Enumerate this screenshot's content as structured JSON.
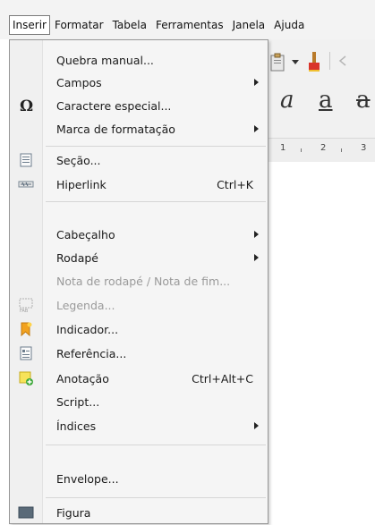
{
  "menubar": {
    "items": [
      {
        "label": "Inserir",
        "active": true
      },
      {
        "label": "Formatar"
      },
      {
        "label": "Tabela"
      },
      {
        "label": "Ferramentas"
      },
      {
        "label": "Janela"
      },
      {
        "label": "Ajuda"
      }
    ]
  },
  "background": {
    "ruler_numbers": [
      "1",
      "2",
      "3"
    ],
    "format_chars": [
      "a",
      "a",
      "a"
    ]
  },
  "insert_menu": {
    "items": [
      {
        "label": "Quebra manual...",
        "icon": "none"
      },
      {
        "label": "Campos",
        "submenu": true
      },
      {
        "label": "Caractere especial...",
        "icon": "omega-icon"
      },
      {
        "label": "Marca de formatação",
        "submenu": true
      },
      {
        "label": "Seção...",
        "icon": "section-icon"
      },
      {
        "label": "Hiperlink",
        "shortcut": "Ctrl+K",
        "icon": "hyperlink-icon"
      },
      {
        "label": "Cabeçalho",
        "submenu": true
      },
      {
        "label": "Rodapé",
        "submenu": true
      },
      {
        "label": "Nota de rodapé / Nota de fim...",
        "disabled": true
      },
      {
        "label": "Legenda...",
        "disabled": true,
        "icon": "caption-icon"
      },
      {
        "label": "Indicador...",
        "icon": "bookmark-icon"
      },
      {
        "label": "Referência...",
        "icon": "reference-icon"
      },
      {
        "label": "Anotação",
        "shortcut": "Ctrl+Alt+C",
        "icon": "comment-icon"
      },
      {
        "label": "Script..."
      },
      {
        "label": "Índices",
        "submenu": true
      },
      {
        "label": "Envelope..."
      },
      {
        "label": "Figura",
        "icon": "picture-icon"
      }
    ]
  }
}
